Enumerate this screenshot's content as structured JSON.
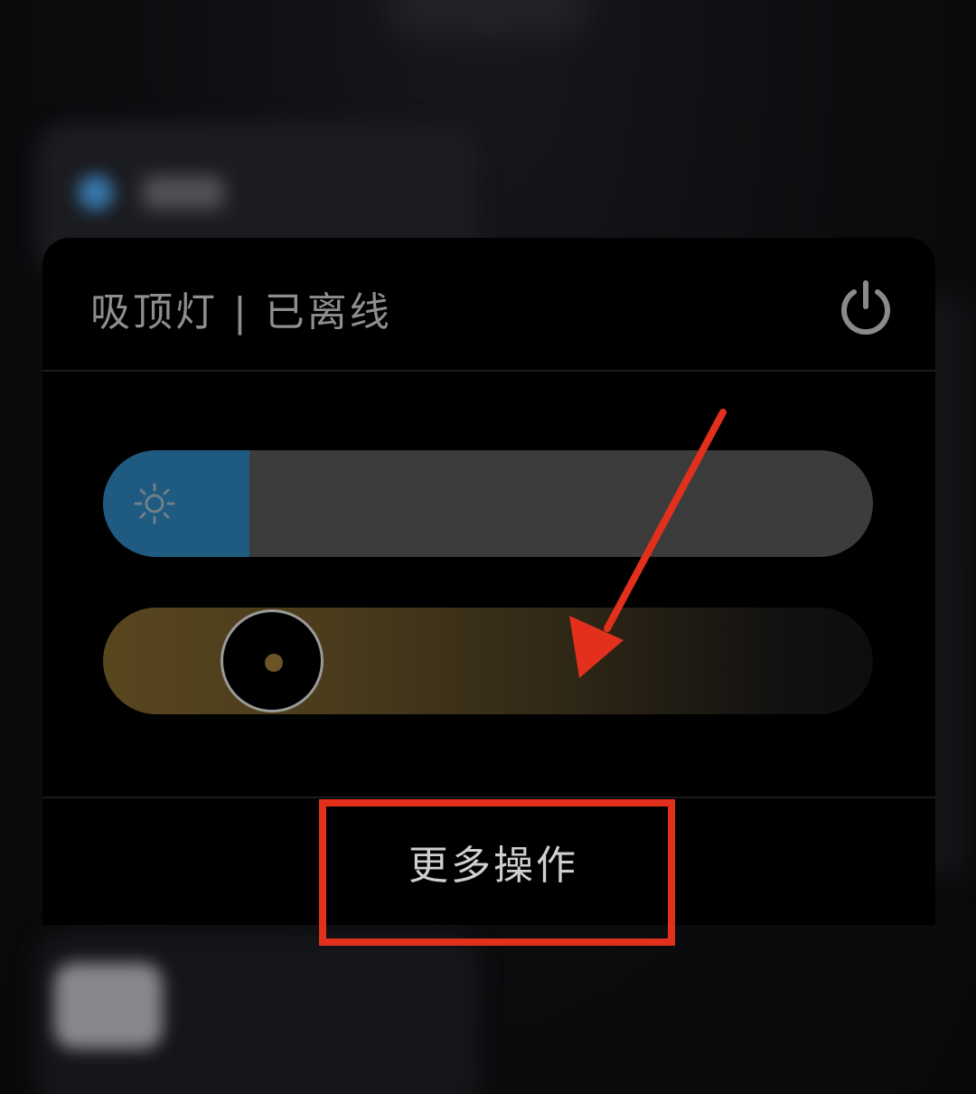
{
  "panel": {
    "title": "吸顶灯 | 已离线",
    "more_actions_label": "更多操作"
  },
  "controls": {
    "brightness_level": 0.19,
    "color_temperature_level": 0.22
  },
  "icons": {
    "power": "power-icon",
    "brightness": "sun-icon"
  },
  "colors": {
    "brightness_fill": "#1f5a80",
    "track": "#3c3c3c",
    "warm": "#58461e",
    "annotation": "#e2301c"
  }
}
